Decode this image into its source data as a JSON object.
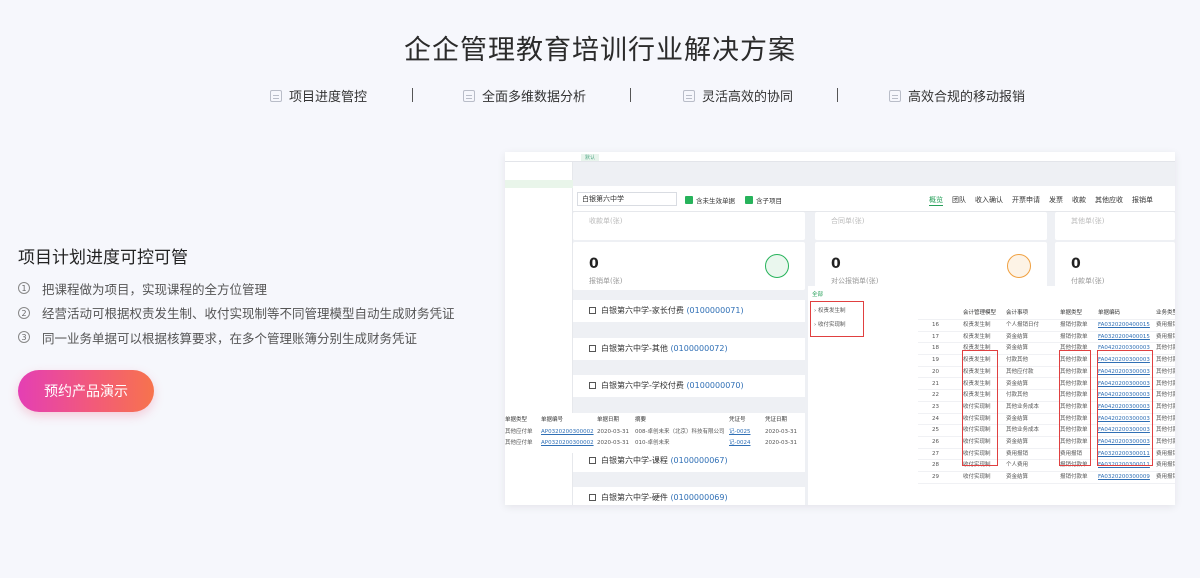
{
  "page": {
    "title": "企企管理教育培训行业解决方案",
    "features": [
      "项目进度管控",
      "全面多维数据分析",
      "灵活高效的协同",
      "高效合规的移动报销"
    ]
  },
  "left": {
    "heading": "项目计划进度可控可管",
    "points": [
      {
        "num": "1",
        "text": "把课程做为项目，实现课程的全方位管理"
      },
      {
        "num": "2",
        "text": "经营活动可根据权责发生制、收付实现制等不同管理模型自动生成财务凭证"
      },
      {
        "num": "3",
        "text": "同一业务单据可以根据核算要求，在多个管理账簿分别生成财务凭证"
      }
    ],
    "cta": "预约产品演示"
  },
  "screenshot": {
    "tab": "默认",
    "org": "白银第六中学",
    "checks": [
      "含未生效单据",
      "含子项目"
    ],
    "nav_tabs": [
      "概览",
      "团队",
      "收入确认",
      "开票申请",
      "发票",
      "收款",
      "其他应收",
      "报销单"
    ],
    "cards": [
      {
        "value": "0",
        "label": "报销单(张)",
        "faint": "收款单(张)"
      },
      {
        "value": "0",
        "label": "对公报销单(张)",
        "faint": "合同单(张)"
      },
      {
        "value": "0",
        "label": "付款单(张)",
        "faint": "其他单(张)"
      }
    ],
    "projects": [
      {
        "name": "白银第六中学-家长付费",
        "code": "(0100000071)"
      },
      {
        "name": "白银第六中学-其他",
        "code": "(0100000072)"
      },
      {
        "name": "白银第六中学-学校付费",
        "code": "(0100000070)"
      },
      {
        "name": "白银第六中学-课程",
        "code": "(0100000067)"
      },
      {
        "name": "白银第六中学-硬件",
        "code": "(0100000069)"
      }
    ],
    "tree": {
      "all": "全部",
      "items": [
        "权责发生制",
        "收付实现制"
      ]
    },
    "table_headers": [
      "会计管理模型",
      "会计事项",
      "单据类型",
      "单据编码",
      "业务类型"
    ],
    "table_rows": [
      [
        "16",
        "权责发生制",
        "个人报销日付",
        "报销付款单",
        "FA0320200400015",
        "费用报销"
      ],
      [
        "17",
        "权责发生制",
        "资金结算",
        "报销付款单",
        "FA0320200400015",
        "费用报销"
      ],
      [
        "18",
        "权责发生制",
        "资金结算",
        "其他付款单",
        "FA0420200300003",
        "其他付款"
      ],
      [
        "19",
        "权责发生制",
        "付款其他",
        "其他付款单",
        "FA0420200300003",
        "其他付款"
      ],
      [
        "20",
        "权责发生制",
        "其他应付款",
        "其他付款单",
        "FA0420200300003",
        "其他付款"
      ],
      [
        "21",
        "权责发生制",
        "资金结算",
        "其他付款单",
        "FA0420200300003",
        "其他付款"
      ],
      [
        "22",
        "权责发生制",
        "付款其他",
        "其他付款单",
        "FA0420200300003",
        "其他付款"
      ],
      [
        "23",
        "收付实现制",
        "其他业务成本",
        "其他付款单",
        "FA0420200300003",
        "其他付款"
      ],
      [
        "24",
        "收付实现制",
        "资金结算",
        "其他付款单",
        "FA0420200300003",
        "其他付款"
      ],
      [
        "25",
        "收付实现制",
        "其他业务成本",
        "其他付款单",
        "FA0420200300003",
        "其他付款"
      ],
      [
        "26",
        "收付实现制",
        "资金结算",
        "其他付款单",
        "FA0420200300003",
        "其他付款"
      ],
      [
        "27",
        "收付实现制",
        "费用报销",
        "费用报销",
        "FA0320200300011",
        "费用报销"
      ],
      [
        "28",
        "收付实现制",
        "个人费用",
        "报销付款单",
        "FA0320200300011",
        "费用报销"
      ],
      [
        "29",
        "收付实现制",
        "资金结算",
        "报销付款单",
        "FA0320200300009",
        "费用报销"
      ]
    ],
    "popup_headers": [
      "单据类型",
      "单据编号",
      "单据日期",
      "摘要",
      "凭证号",
      "凭证日期"
    ],
    "popup_rows": [
      [
        "其他应付单",
        "AP0320200300002",
        "2020-03-31",
        "008-卓创未来（北京）科技有限公司",
        "记-0025",
        "2020-03-31"
      ],
      [
        "其他应付单",
        "AP0320200300002",
        "2020-03-31",
        "010-卓创未来",
        "记-0024",
        "2020-03-31"
      ]
    ]
  }
}
